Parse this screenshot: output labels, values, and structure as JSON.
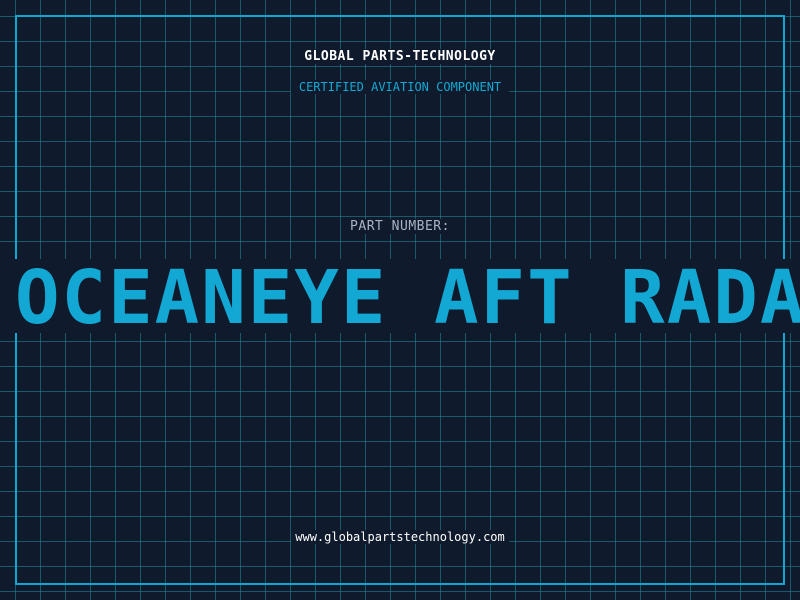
{
  "header": {
    "company": "GLOBAL PARTS-TECHNOLOGY",
    "subtitle": "CERTIFIED AVIATION COMPONENT"
  },
  "part": {
    "label": "PART NUMBER:",
    "name": "OCEANEYE AFT RADAR"
  },
  "footer": {
    "url": "www.globalpartstechnology.com"
  },
  "colors": {
    "background": "#0f1a2c",
    "accent": "#13a8d3",
    "grid": "#228ba0",
    "text": "#ffffff",
    "label": "#a9b5c6"
  }
}
